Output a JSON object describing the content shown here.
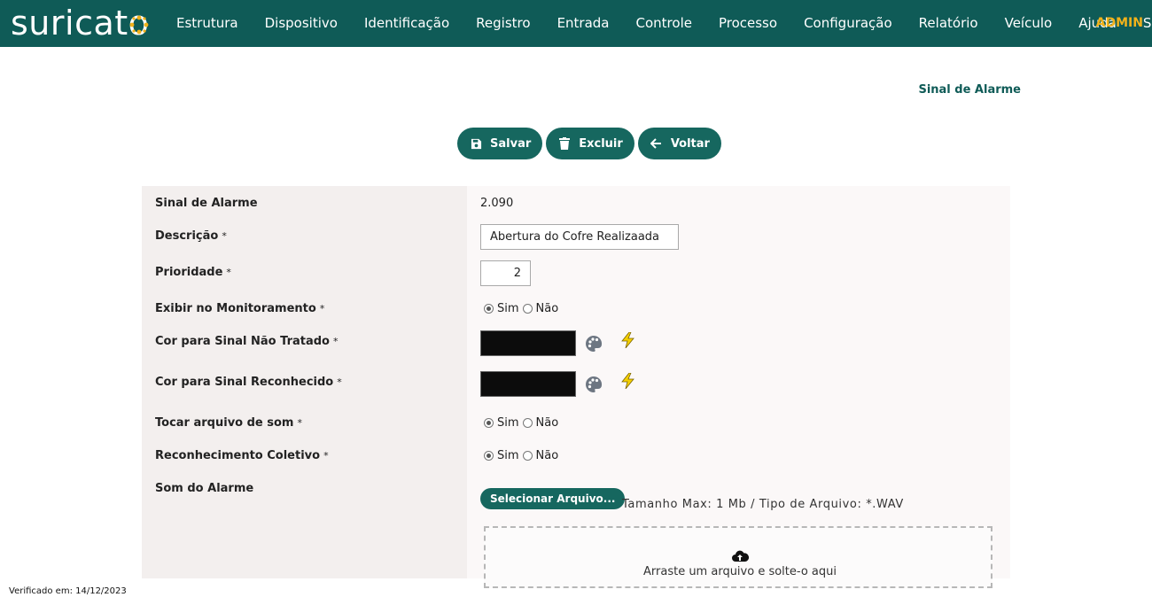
{
  "brand": {
    "name": "suricato"
  },
  "nav": {
    "items": [
      "Estrutura",
      "Dispositivo",
      "Identificação",
      "Registro",
      "Entrada",
      "Controle",
      "Processo",
      "Configuração",
      "Relatório",
      "Veículo",
      "Ajuda",
      "Sair"
    ],
    "user": "ADMIN"
  },
  "page": {
    "title": "Sinal de Alarme"
  },
  "toolbar": {
    "save": "Salvar",
    "delete": "Excluir",
    "back": "Voltar"
  },
  "form": {
    "sinal": {
      "label": "Sinal de Alarme",
      "value": "2.090"
    },
    "descricao": {
      "label": "Descrição",
      "required": "*",
      "value": "Abertura do Cofre Realizaada"
    },
    "prioridade": {
      "label": "Prioridade",
      "required": "*",
      "value": "2"
    },
    "exibir": {
      "label": "Exibir no Monitoramento",
      "required": "*",
      "yes": "Sim",
      "no": "Não",
      "selected": "Sim"
    },
    "cor_nao_tratado": {
      "label": "Cor para Sinal Não Tratado",
      "required": "*",
      "color": "#0c0c0c"
    },
    "cor_reconhecido": {
      "label": "Cor para Sinal Reconhecido",
      "required": "*",
      "color": "#0c0c0c"
    },
    "tocar_som": {
      "label": "Tocar arquivo de som",
      "required": "*",
      "yes": "Sim",
      "no": "Não",
      "selected": "Sim"
    },
    "reconhecimento": {
      "label": "Reconhecimento Coletivo",
      "required": "*",
      "yes": "Sim",
      "no": "Não",
      "selected": "Sim"
    },
    "som": {
      "label": "Som do Alarme",
      "button": "Selecionar Arquivo...",
      "hint": "Tamanho Max: 1 Mb / Tipo de Arquivo: *.WAV",
      "drop_text": "Arraste um arquivo e solte-o aqui"
    }
  },
  "footer": {
    "verified": "Verificado em: 14/12/2023"
  },
  "colors": {
    "primary": "#0f5b57",
    "button": "#16675f",
    "admin": "#f2b21a",
    "bolt": "#f5d000"
  }
}
